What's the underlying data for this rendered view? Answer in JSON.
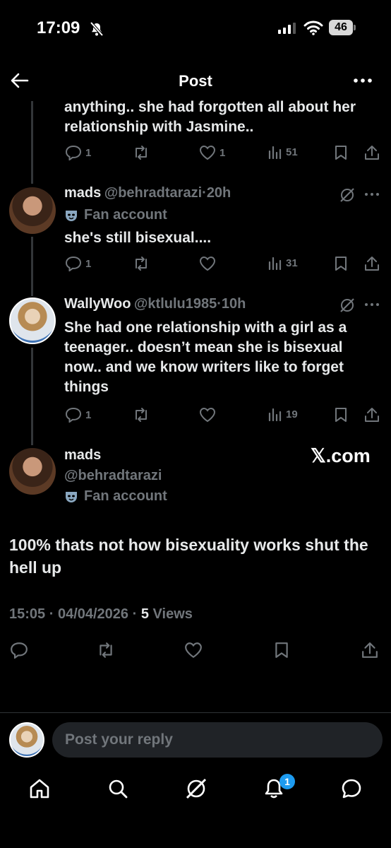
{
  "status_bar": {
    "time": "17:09",
    "battery": "46"
  },
  "header": {
    "title": "Post"
  },
  "reply_top": {
    "text": "anything.. she had forgotten all about her relationship with Jasmine..",
    "replies": "1",
    "likes": "1",
    "views": "51"
  },
  "reply_mads": {
    "name": "mads",
    "handle": "@behradtarazi",
    "time": "20h",
    "fan_label": "Fan account",
    "text": "she's still bisexual....",
    "replies": "1",
    "views": "31"
  },
  "reply_wally": {
    "name": "WallyWoo",
    "handle": "@ktlulu1985",
    "time": "10h",
    "text": "She had one relationship with a girl as a teenager.. doesn’t mean she is bisexual now.. and we know writers like to forget things",
    "replies": "1",
    "views": "19"
  },
  "main_post": {
    "name": "mads",
    "handle": "@behradtarazi",
    "fan_label": "Fan account",
    "watermark": "𝕏.com",
    "text": "100% thats not how bisexuality works shut the hell up",
    "time": "15:05",
    "date": "04/04/2026",
    "views_count": "5",
    "views_label": "Views"
  },
  "compose": {
    "placeholder": "Post your reply"
  },
  "bottom_nav": {
    "notifications_badge": "1"
  },
  "icons": [
    "back-arrow-icon",
    "more-icon",
    "reply-icon",
    "repost-icon",
    "like-icon",
    "views-icon",
    "bookmark-icon",
    "share-icon",
    "grok-icon",
    "home-icon",
    "search-icon",
    "bell-icon",
    "messages-icon"
  ]
}
